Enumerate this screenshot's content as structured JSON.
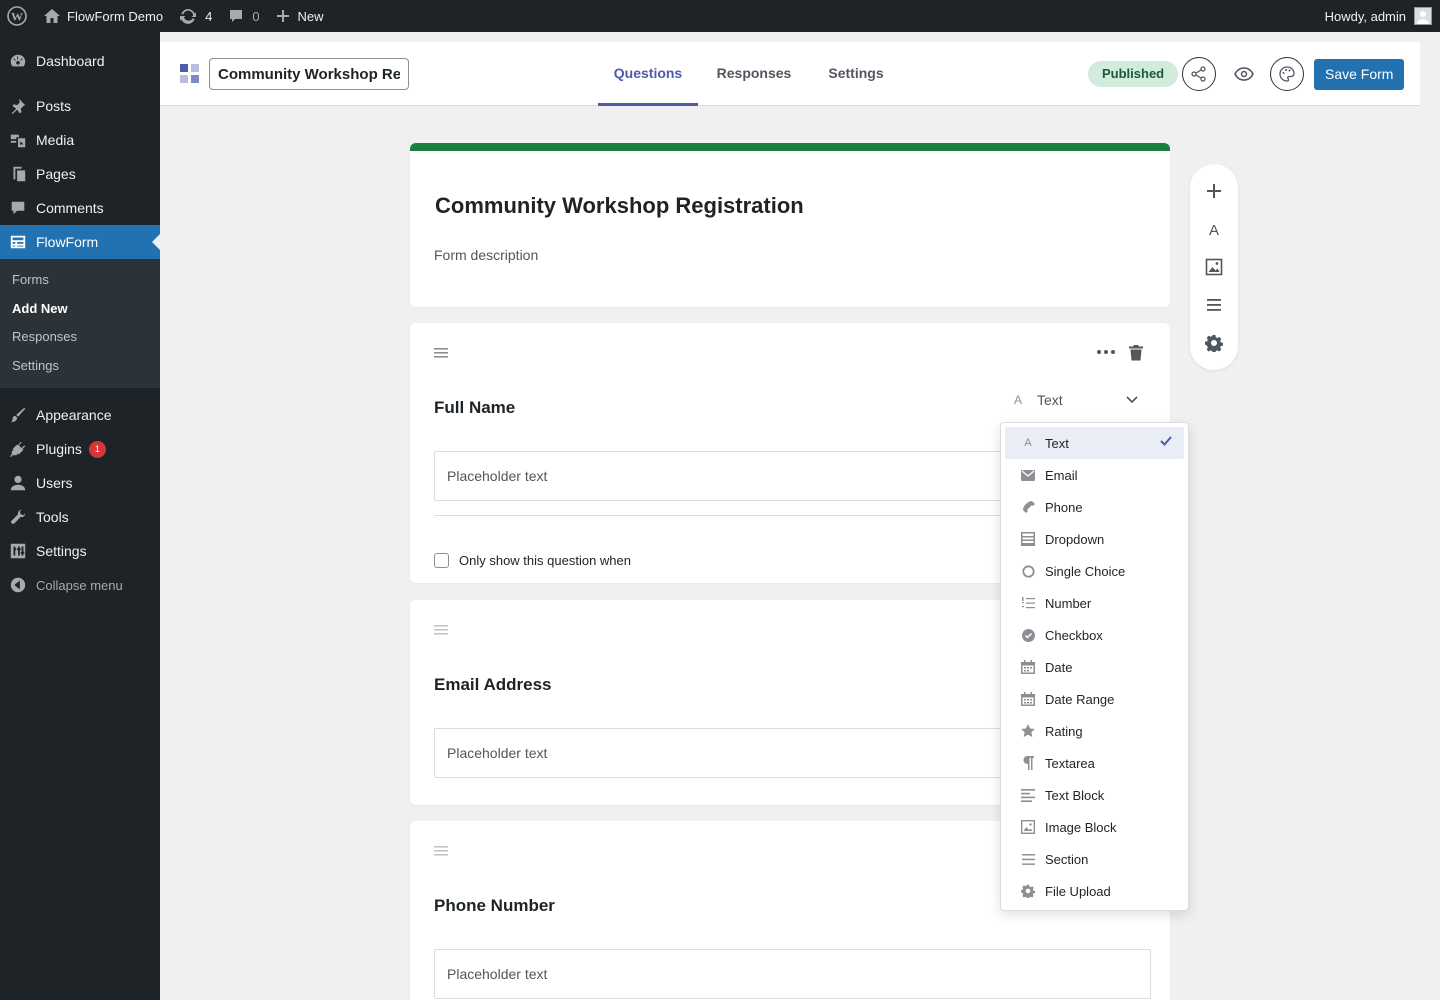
{
  "adminbar": {
    "site_name": "FlowForm Demo",
    "updates_count": "4",
    "comments_count": "0",
    "new_label": "New",
    "howdy": "Howdy, admin"
  },
  "sidebar": {
    "items": [
      {
        "label": "Dashboard",
        "icon": "dashboard-icon"
      },
      {
        "label": "Posts",
        "icon": "pin-icon"
      },
      {
        "label": "Media",
        "icon": "media-icon"
      },
      {
        "label": "Pages",
        "icon": "pages-icon"
      },
      {
        "label": "Comments",
        "icon": "comments-icon"
      },
      {
        "label": "FlowForm",
        "icon": "form-icon"
      }
    ],
    "submenu": [
      "Forms",
      "Add New",
      "Responses",
      "Settings"
    ],
    "lower_items": [
      {
        "label": "Appearance",
        "icon": "brush-icon"
      },
      {
        "label": "Plugins",
        "icon": "plugin-icon",
        "badge": "1"
      },
      {
        "label": "Users",
        "icon": "users-icon"
      },
      {
        "label": "Tools",
        "icon": "wrench-icon"
      },
      {
        "label": "Settings",
        "icon": "settings-icon"
      }
    ],
    "collapse_label": "Collapse menu"
  },
  "header": {
    "form_name": "Community Workshop Registration",
    "tabs": [
      "Questions",
      "Responses",
      "Settings"
    ],
    "status": "Published",
    "save_label": "Save Form"
  },
  "form": {
    "title": "Community Workshop Registration",
    "description": "Form description",
    "questions": [
      {
        "label": "Full Name",
        "placeholder": "Placeholder text",
        "type": "Text",
        "condition_label": "Only show this question when"
      },
      {
        "label": "Email Address",
        "placeholder": "Placeholder text"
      },
      {
        "label": "Phone Number",
        "placeholder": "Placeholder text"
      }
    ]
  },
  "type_menu": {
    "options": [
      "Text",
      "Email",
      "Phone",
      "Dropdown",
      "Single Choice",
      "Number",
      "Checkbox",
      "Date",
      "Date Range",
      "Rating",
      "Textarea",
      "Text Block",
      "Image Block",
      "Section",
      "File Upload"
    ],
    "selected": "Text"
  },
  "colors": {
    "accent": "#2271b1",
    "tab_active": "#4f5aa8",
    "title_bar": "#1a7f3e",
    "status_bg": "#d1ebdd"
  }
}
